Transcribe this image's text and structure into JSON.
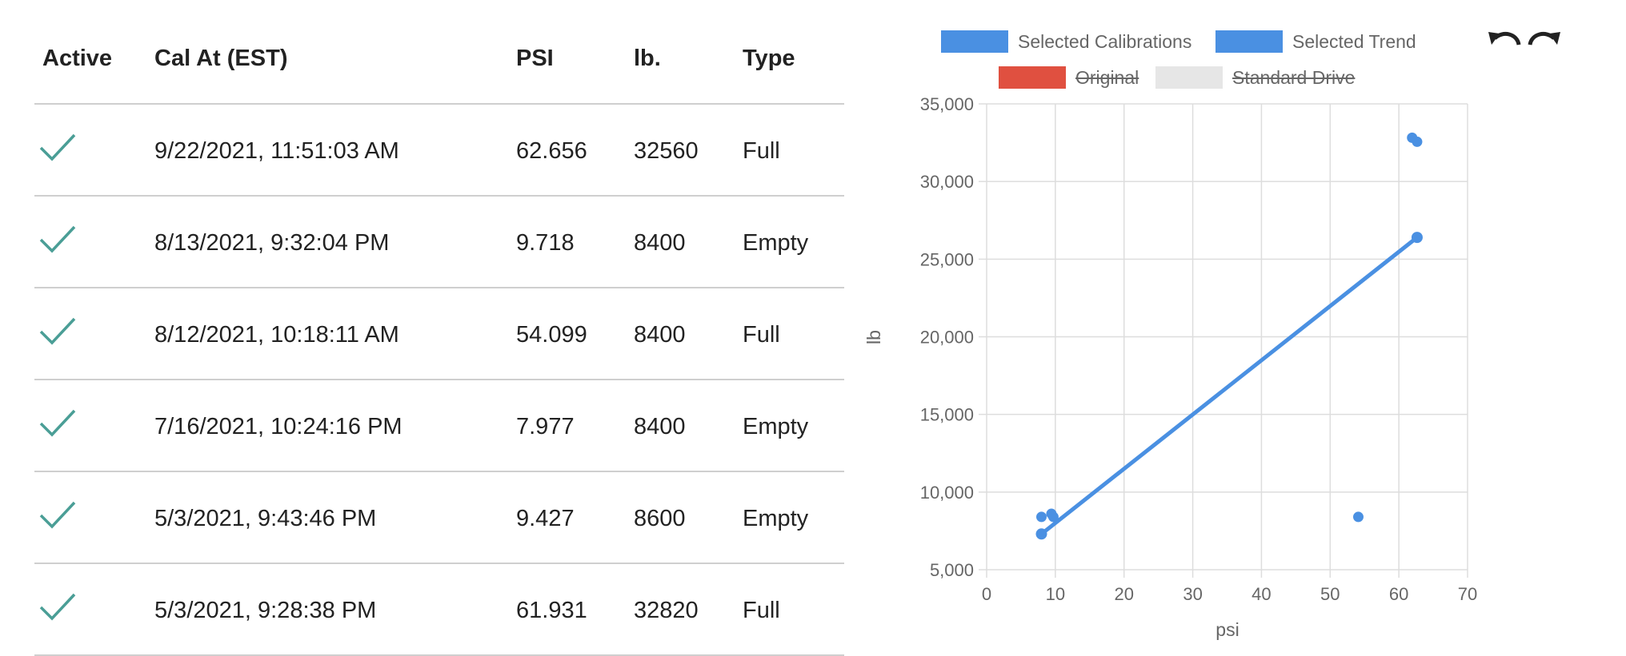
{
  "table": {
    "headers": {
      "active": "Active",
      "cal_at": "Cal At (EST)",
      "psi": "PSI",
      "lb": "lb.",
      "type": "Type"
    },
    "rows": [
      {
        "cal_at": "9/22/2021, 11:51:03 AM",
        "psi": "62.656",
        "lb": "32560",
        "type": "Full",
        "active": true
      },
      {
        "cal_at": "8/13/2021, 9:32:04 PM",
        "psi": "9.718",
        "lb": "8400",
        "type": "Empty",
        "active": true
      },
      {
        "cal_at": "8/12/2021, 10:18:11 AM",
        "psi": "54.099",
        "lb": "8400",
        "type": "Full",
        "active": true
      },
      {
        "cal_at": "7/16/2021, 10:24:16 PM",
        "psi": "7.977",
        "lb": "8400",
        "type": "Empty",
        "active": true
      },
      {
        "cal_at": "5/3/2021, 9:43:46 PM",
        "psi": "9.427",
        "lb": "8600",
        "type": "Empty",
        "active": true
      },
      {
        "cal_at": "5/3/2021, 9:28:38 PM",
        "psi": "61.931",
        "lb": "32820",
        "type": "Full",
        "active": true
      }
    ],
    "check_color": "#4a9e96"
  },
  "toolbar": {
    "undo_icon": "undo-icon",
    "redo_icon": "redo-icon"
  },
  "legend": [
    {
      "label": "Selected Calibrations",
      "color": "#4a90e2",
      "hidden": false
    },
    {
      "label": "Selected Trend",
      "color": "#4a90e2",
      "hidden": false
    },
    {
      "label": "Original",
      "color": "#e05040",
      "hidden": true
    },
    {
      "label": "Standard Drive",
      "color": "#e6e6e6",
      "hidden": true
    }
  ],
  "chart_data": {
    "type": "scatter",
    "xlabel": "psi",
    "ylabel": "lb",
    "xlim": [
      0,
      70
    ],
    "ylim": [
      5000,
      35000
    ],
    "x_ticks": [
      "0",
      "10",
      "20",
      "30",
      "40",
      "50",
      "60",
      "70"
    ],
    "y_ticks": [
      "5,000",
      "10,000",
      "15,000",
      "20,000",
      "25,000",
      "30,000",
      "35,000"
    ],
    "grid": true,
    "legend_position": "top",
    "series": [
      {
        "name": "Selected Calibrations",
        "color": "#4a90e2",
        "points": [
          {
            "x": 62.656,
            "y": 32560
          },
          {
            "x": 9.718,
            "y": 8400
          },
          {
            "x": 54.099,
            "y": 8400
          },
          {
            "x": 7.977,
            "y": 8400
          },
          {
            "x": 9.427,
            "y": 8600
          },
          {
            "x": 61.931,
            "y": 32820
          }
        ]
      },
      {
        "name": "Selected Trend",
        "color": "#4a90e2",
        "line": [
          {
            "x": 7.977,
            "y": 7300
          },
          {
            "x": 62.656,
            "y": 26400
          }
        ]
      }
    ]
  }
}
